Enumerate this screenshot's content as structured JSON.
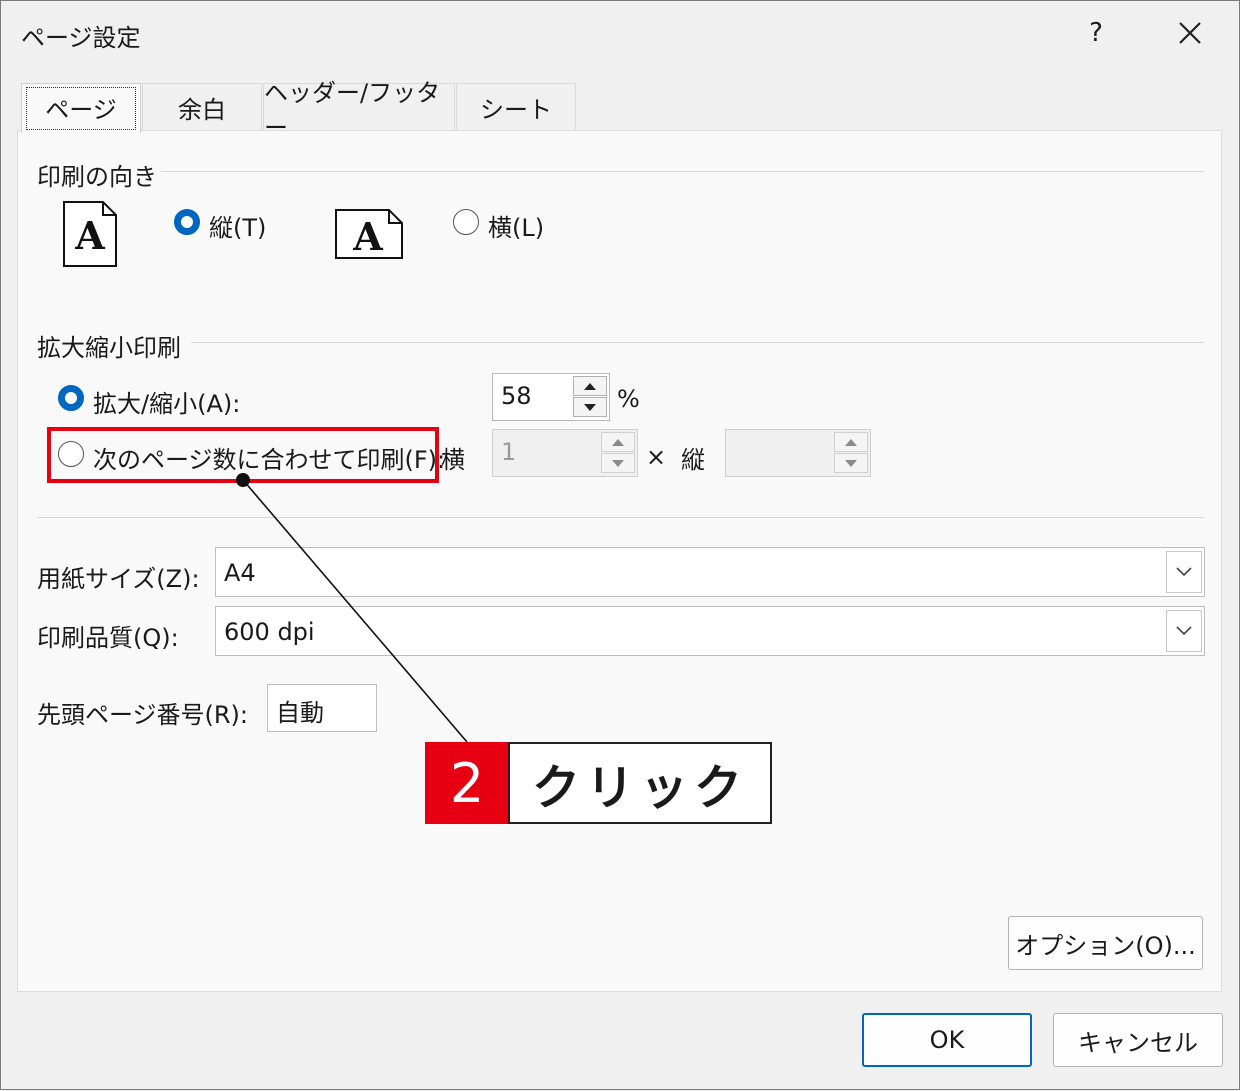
{
  "window": {
    "title": "ページ設定",
    "help": "?"
  },
  "tabs": [
    {
      "label": "ページ",
      "active": true
    },
    {
      "label": "余白",
      "active": false
    },
    {
      "label": "ヘッダー/フッター",
      "active": false
    },
    {
      "label": "シート",
      "active": false
    }
  ],
  "orientation": {
    "group_label": "印刷の向き",
    "portrait": {
      "label": "縦(T)",
      "checked": true
    },
    "landscape": {
      "label": "横(L)",
      "checked": false
    }
  },
  "scaling": {
    "group_label": "拡大縮小印刷",
    "adjust": {
      "label": "拡大/縮小(A):",
      "checked": true,
      "value": "58",
      "unit": "%"
    },
    "fit": {
      "label": "次のページ数に合わせて印刷(F):",
      "checked": false,
      "wide_label": "横",
      "wide_value": "1",
      "times": "×",
      "tall_label": "縦",
      "tall_value": ""
    }
  },
  "paper": {
    "size_label": "用紙サイズ(Z):",
    "size_value": "A4",
    "quality_label": "印刷品質(Q):",
    "quality_value": "600 dpi",
    "first_page_label": "先頭ページ番号(R):",
    "first_page_value": "自動"
  },
  "buttons": {
    "options": "オプション(O)...",
    "ok": "OK",
    "cancel": "キャンセル"
  },
  "annotation": {
    "step": "2",
    "text": "クリック"
  },
  "colors": {
    "accent": "#0067c0",
    "highlight": "#e60012"
  }
}
